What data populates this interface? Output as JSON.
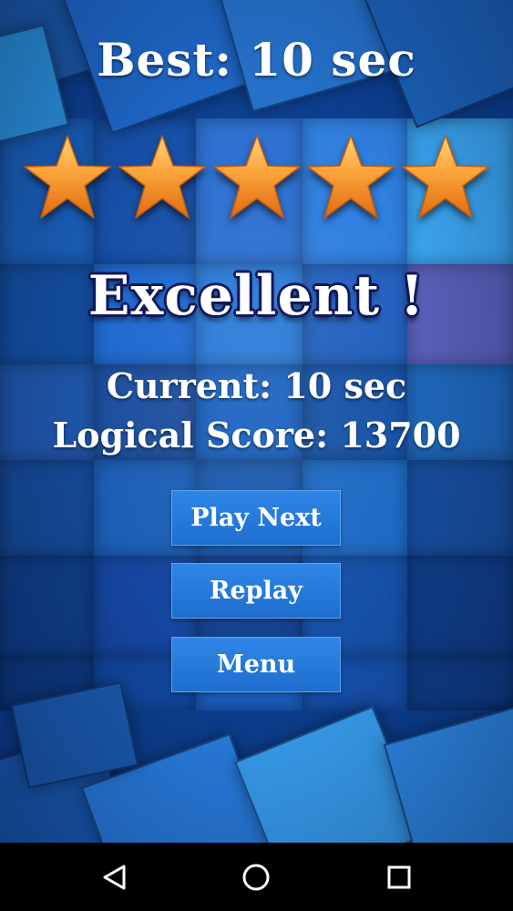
{
  "game": {
    "best_text": "Best: 10 sec",
    "stars_earned": 5,
    "stars_total": 5,
    "rating_text": "Excellent !",
    "current_text": "Current: 10 sec",
    "score_text": "Logical Score: 13700"
  },
  "buttons": {
    "play_next": "Play Next",
    "replay": "Replay",
    "menu": "Menu"
  },
  "navbar": {
    "back_icon": "back-triangle-icon",
    "home_icon": "home-circle-icon",
    "recents_icon": "recents-square-icon"
  },
  "colors": {
    "star_fill": "#f79a2a",
    "button": "#2679de",
    "background": "#0d3f8f"
  }
}
